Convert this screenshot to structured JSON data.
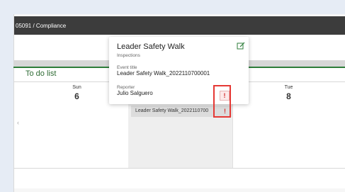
{
  "breadcrumb": {
    "text": "05091  /  Compliance"
  },
  "section": {
    "title": "To do list"
  },
  "calendar": {
    "days": [
      {
        "name": "Sun",
        "number": "6"
      },
      {
        "name": "",
        "number": ""
      },
      {
        "name": "Tue",
        "number": "8"
      }
    ],
    "event": {
      "label": "Leader Safety Walk_2022110700",
      "flag": "!"
    }
  },
  "popup": {
    "title": "Leader Safety Walk",
    "type": "Inspections",
    "event_title_label": "Event title",
    "event_title_value": "Leader Safety Walk_2022110700001",
    "reporter_label": "Reporter",
    "reporter_value": "Julio Salguero",
    "flag": "!"
  },
  "icons": {
    "edit": "edit-icon",
    "nav": "chevron-left-icon",
    "flag": "exclamation-icon"
  },
  "colors": {
    "accent": "#2e7d3a",
    "alert": "#d32f2f",
    "topbar": "#3c3c3c"
  }
}
